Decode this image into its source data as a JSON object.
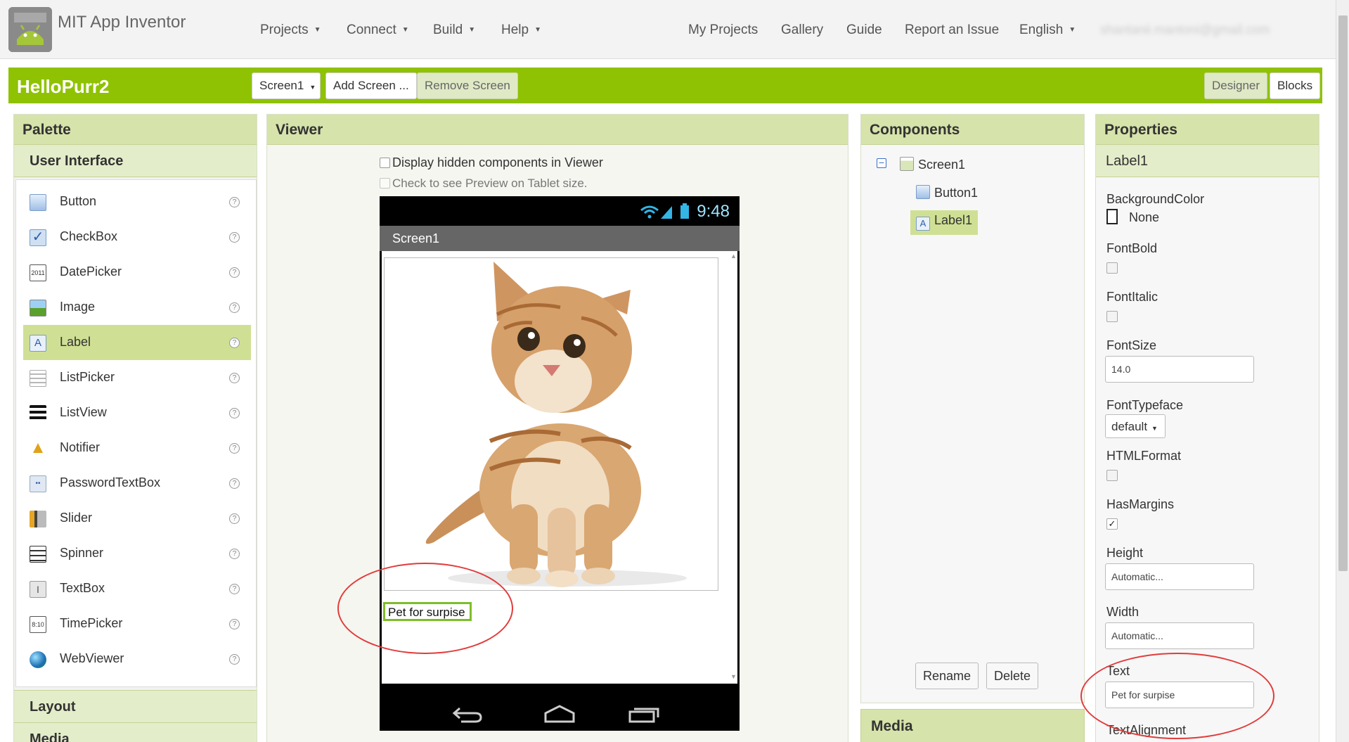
{
  "header": {
    "app_title": "MIT App Inventor",
    "menus": [
      "Projects",
      "Connect",
      "Build",
      "Help"
    ],
    "links": [
      "My Projects",
      "Gallery",
      "Guide",
      "Report an Issue"
    ],
    "language": "English",
    "account": "shantanii.mantoni@gmail.com"
  },
  "toolbar": {
    "project_name": "HelloPurr2",
    "screen_select": "Screen1",
    "add_screen": "Add Screen ...",
    "remove_screen": "Remove Screen",
    "designer": "Designer",
    "blocks": "Blocks"
  },
  "palette": {
    "title": "Palette",
    "section": "User Interface",
    "items": [
      {
        "label": "Button",
        "icon": "button-icon"
      },
      {
        "label": "CheckBox",
        "icon": "checkbox-icon"
      },
      {
        "label": "DatePicker",
        "icon": "datepicker-icon"
      },
      {
        "label": "Image",
        "icon": "image-icon"
      },
      {
        "label": "Label",
        "icon": "label-icon",
        "selected": true
      },
      {
        "label": "ListPicker",
        "icon": "listpicker-icon"
      },
      {
        "label": "ListView",
        "icon": "listview-icon"
      },
      {
        "label": "Notifier",
        "icon": "notifier-icon"
      },
      {
        "label": "PasswordTextBox",
        "icon": "password-icon"
      },
      {
        "label": "Slider",
        "icon": "slider-icon"
      },
      {
        "label": "Spinner",
        "icon": "spinner-icon"
      },
      {
        "label": "TextBox",
        "icon": "textbox-icon"
      },
      {
        "label": "TimePicker",
        "icon": "timepicker-icon"
      },
      {
        "label": "WebViewer",
        "icon": "webviewer-icon"
      }
    ],
    "help_glyph": "?",
    "more_sections": [
      "Layout",
      "Media"
    ]
  },
  "viewer": {
    "title": "Viewer",
    "hidden_checkbox": "Display hidden components in Viewer",
    "tablet_checkbox": "Check to see Preview on Tablet size.",
    "phone_time": "9:48",
    "screen_title": "Screen1",
    "label_text": "Pet for surpise"
  },
  "components": {
    "title": "Components",
    "tree": [
      "Screen1",
      "Button1",
      "Label1"
    ],
    "selected": "Label1",
    "rename": "Rename",
    "delete": "Delete",
    "media": "Media"
  },
  "properties": {
    "title": "Properties",
    "component": "Label1",
    "background_color_label": "BackgroundColor",
    "background_color_value": "None",
    "fontbold_label": "FontBold",
    "fontbold_checked": false,
    "fontitalic_label": "FontItalic",
    "fontitalic_checked": false,
    "fontsize_label": "FontSize",
    "fontsize_value": "14.0",
    "fonttypeface_label": "FontTypeface",
    "fonttypeface_value": "default",
    "htmlformat_label": "HTMLFormat",
    "htmlformat_checked": false,
    "hasmargins_label": "HasMargins",
    "hasmargins_checked": true,
    "height_label": "Height",
    "height_value": "Automatic...",
    "width_label": "Width",
    "width_value": "Automatic...",
    "text_label": "Text",
    "text_value": "Pet for surpise",
    "textalignment_label": "TextAlignment"
  },
  "colors": {
    "brand_green": "#8fc202",
    "panel_header": "#d6e3aa",
    "selection": "#cfe094",
    "annotation_red": "#e23b3b"
  }
}
